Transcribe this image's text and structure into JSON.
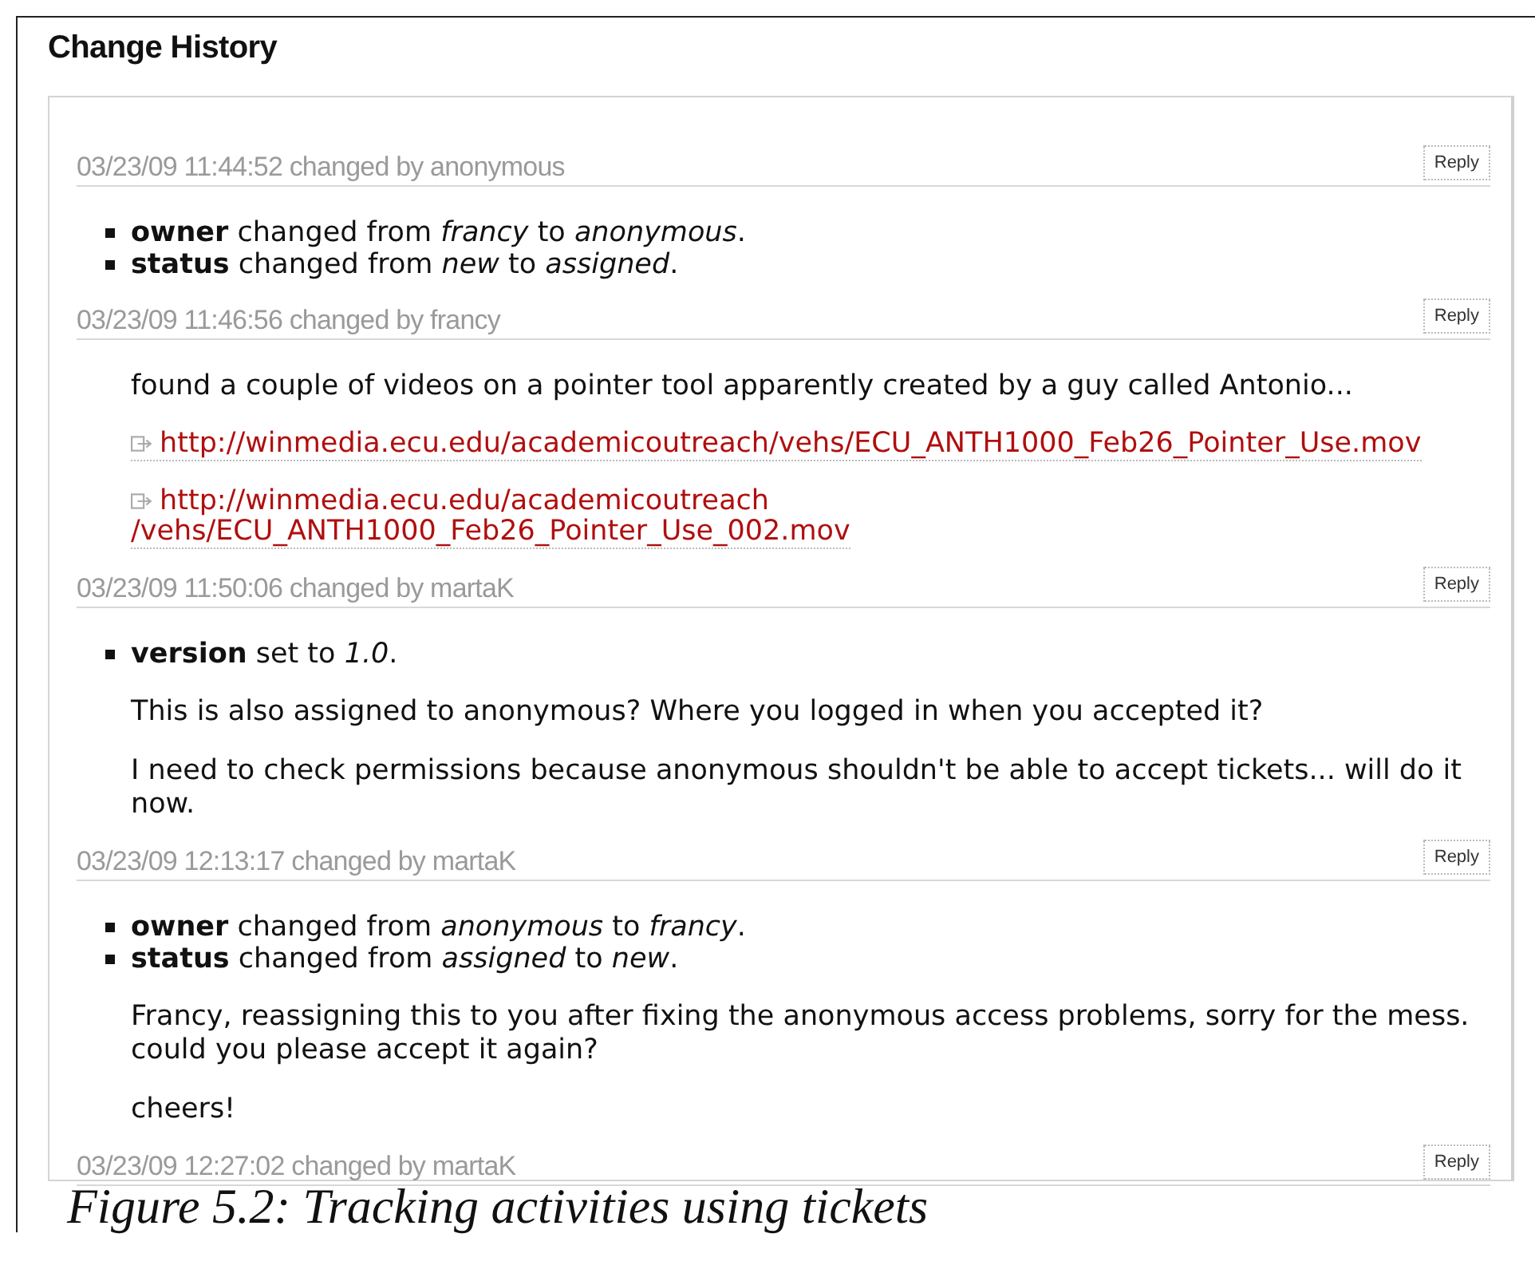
{
  "section_title": "Change History",
  "entries": [
    {
      "header": "03/23/09 11:44:52 changed by anonymous",
      "reply": "Reply",
      "changes": [
        "**owner** changed from *francy* to *anonymous*.",
        "**status** changed from *new* to *assigned*."
      ]
    },
    {
      "header": "03/23/09 11:46:56 changed by francy",
      "reply": "Reply",
      "body": [
        {
          "kind": "text",
          "lines": [
            "found a couple of videos on a pointer tool apparently created by a guy called Antonio..."
          ]
        },
        {
          "kind": "link",
          "lines": [
            "http://winmedia.ecu.edu/academicoutreach/vehs/ECU_ANTH1000_Feb26_Pointer_Use.mov"
          ]
        },
        {
          "kind": "link",
          "lines": [
            "http://winmedia.ecu.edu/academicoutreach",
            "/vehs/ECU_ANTH1000_Feb26_Pointer_Use_002.mov"
          ]
        }
      ]
    },
    {
      "header": "03/23/09 11:50:06 changed by martaK",
      "reply": "Reply",
      "changes": [
        "**version** set to *1.0*."
      ],
      "body": [
        {
          "kind": "text",
          "lines": [
            "This is also assigned to anonymous? Where you logged in when you accepted it?"
          ]
        },
        {
          "kind": "text",
          "lines": [
            "I need to check permissions because anonymous shouldn't be able to accept tickets... will do it",
            "now."
          ]
        }
      ]
    },
    {
      "header": "03/23/09 12:13:17 changed by martaK",
      "reply": "Reply",
      "changes": [
        "**owner** changed from *anonymous* to *francy*.",
        "**status** changed from *assigned* to *new*."
      ],
      "body": [
        {
          "kind": "text",
          "lines": [
            "Francy, reassigning this to you after fixing the anonymous access problems, sorry for the mess.",
            "could you please accept it again?"
          ]
        },
        {
          "kind": "text",
          "lines": [
            "cheers!"
          ]
        }
      ]
    },
    {
      "header": "03/23/09 12:27:02 changed by martaK",
      "reply": "Reply"
    }
  ],
  "caption": "Figure 5.2: Tracking activities using tickets"
}
